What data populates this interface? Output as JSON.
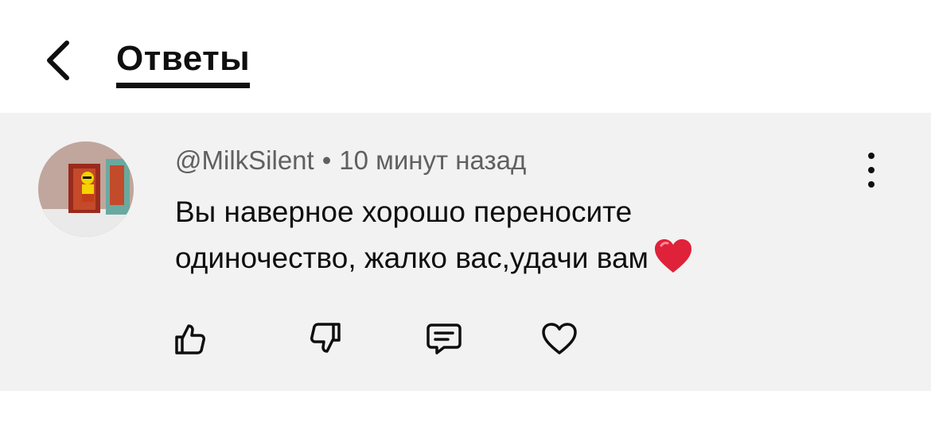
{
  "header": {
    "title": "Ответы",
    "back_icon": "chevron-left-icon"
  },
  "comment": {
    "author": "@MilkSilent",
    "separator": "•",
    "time": "10 минут назад",
    "text_line1": "Вы наверное хорошо переносите",
    "text_line2": "одиночество, жалко вас,удачи вам",
    "emoji": "red-heart-emoji",
    "actions": {
      "like_icon": "thumbs-up-icon",
      "dislike_icon": "thumbs-down-icon",
      "reply_icon": "reply-comment-icon",
      "heart_icon": "heart-outline-icon"
    },
    "more_icon": "more-vertical-icon"
  },
  "colors": {
    "background": "#ffffff",
    "comment_background": "#f2f2f2",
    "text_primary": "#0f0f0f",
    "text_secondary": "#606060",
    "heart": "#e0213a"
  }
}
